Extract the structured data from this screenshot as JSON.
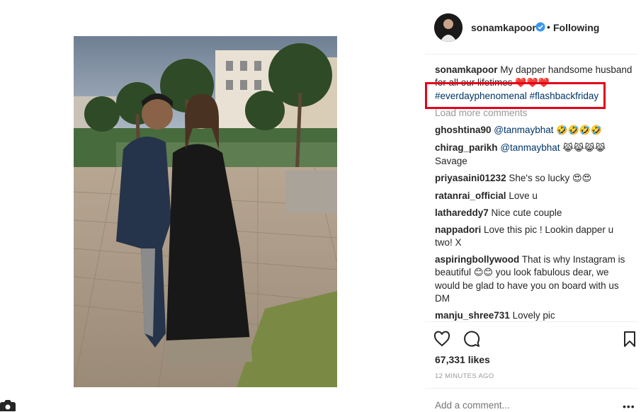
{
  "post": {
    "username": "sonamkapoor",
    "follow_status": "Following",
    "dot": "•",
    "caption": {
      "user": "sonamkapoor",
      "text": "My dapper handsome husband for all our lifetimes",
      "hearts": "❤️❤️❤️",
      "hashtags": "#everdayphenomenal #flashbackfriday"
    },
    "load_more": "Load more comments",
    "comments": [
      {
        "user": "ghoshtina90",
        "mention": "@tanmaybhat",
        "text": "",
        "emoji": "🤣🤣🤣🤣"
      },
      {
        "user": "chirag_parikh",
        "mention": "@tanmaybhat",
        "text": "Savage",
        "emoji": "😹😹😹😹"
      },
      {
        "user": "priyasaini01232",
        "mention": "",
        "text": "She's so lucky",
        "emoji": "😍😍"
      },
      {
        "user": "ratanrai_official",
        "mention": "",
        "text": "Love u",
        "emoji": ""
      },
      {
        "user": "lathareddy7",
        "mention": "",
        "text": "Nice cute couple",
        "emoji": ""
      },
      {
        "user": "nappadori",
        "mention": "",
        "text": "Love this pic ! Lookin dapper u two! X",
        "emoji": ""
      },
      {
        "user": "aspiringbollywood",
        "mention": "",
        "text_a": "That is why Instagram is beautiful",
        "emoji": "😊😊",
        "text_b": "you look fabulous dear, we would be glad to have you on board with us DM"
      },
      {
        "user": "manju_shree731",
        "mention": "",
        "text": "Lovely pic",
        "emoji": ""
      }
    ],
    "likes": "67,331 likes",
    "time": "12 MINUTES AGO",
    "add_comment_placeholder": "Add a comment...",
    "more_options": "•••"
  },
  "colors": {
    "highlight_border": "#e3001b",
    "hashtag": "#003569",
    "verified": "#3897f0"
  },
  "icons": [
    "heart-icon",
    "comment-icon",
    "bookmark-icon",
    "verified-badge-icon",
    "more-options-icon"
  ]
}
